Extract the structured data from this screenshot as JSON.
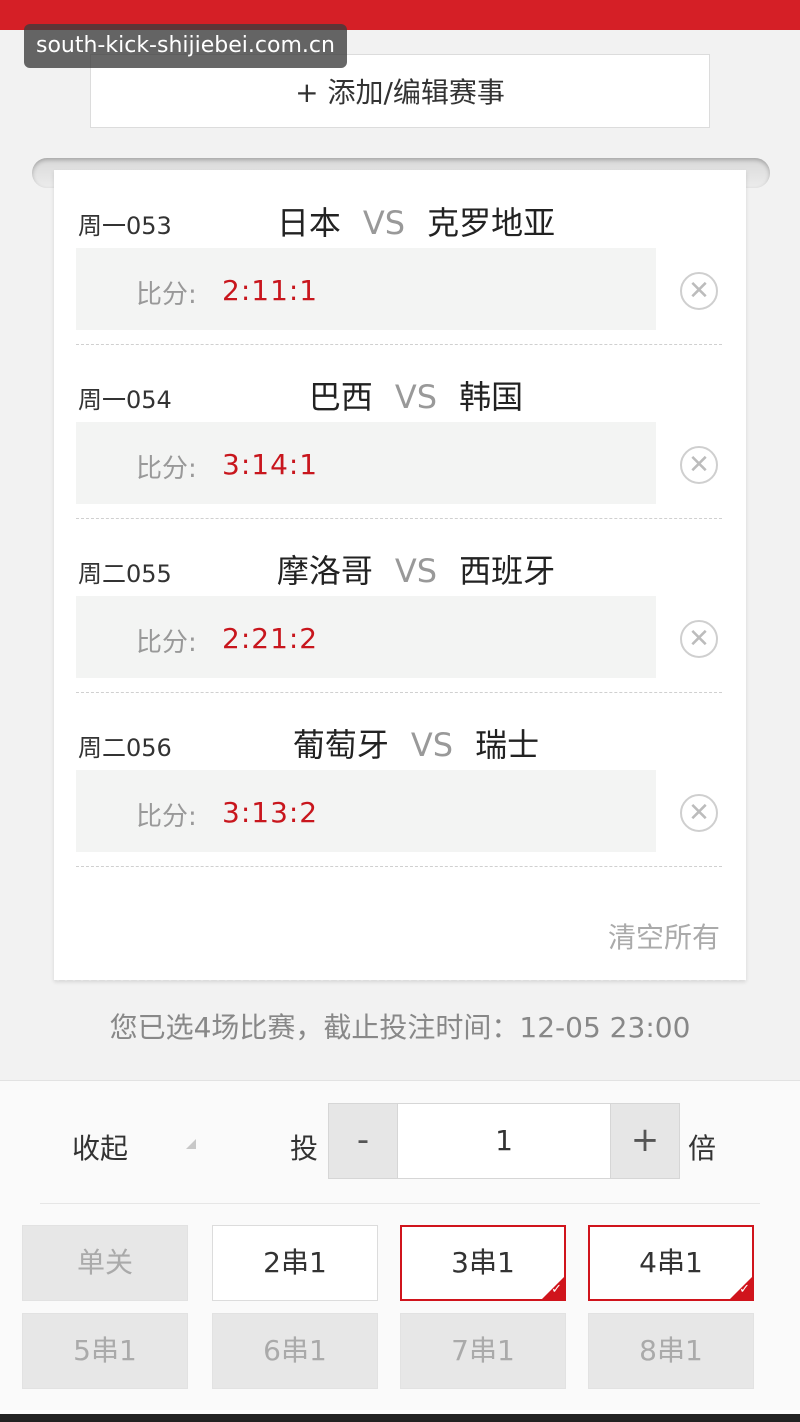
{
  "header": {
    "watermark": "south-kick-shijiebei.com.cn"
  },
  "add_button": {
    "icon": "plus-icon",
    "label": "+ 添加/编辑赛事"
  },
  "score_label": "比分:",
  "matches": [
    {
      "code": "周一053",
      "home": "日本",
      "vs": "VS",
      "away": "克罗地亚",
      "score": "2:11:1"
    },
    {
      "code": "周一054",
      "home": "巴西",
      "vs": "VS",
      "away": "韩国",
      "score": "3:14:1"
    },
    {
      "code": "周二055",
      "home": "摩洛哥",
      "vs": "VS",
      "away": "西班牙",
      "score": "2:21:2"
    },
    {
      "code": "周二056",
      "home": "葡萄牙",
      "vs": "VS",
      "away": "瑞士",
      "score": "3:13:2"
    }
  ],
  "clear_all": "清空所有",
  "summary": "您已选4场比赛，截止投注时间：12-05 23:00",
  "bet": {
    "collapse": "收起",
    "label_before": "投",
    "minus": "-",
    "multiplier": "1",
    "plus": "+",
    "label_after": "倍"
  },
  "combos": [
    {
      "label": "单关",
      "state": "disabled"
    },
    {
      "label": "2串1",
      "state": "normal"
    },
    {
      "label": "3串1",
      "state": "selected"
    },
    {
      "label": "4串1",
      "state": "selected"
    },
    {
      "label": "5串1",
      "state": "disabled"
    },
    {
      "label": "6串1",
      "state": "disabled"
    },
    {
      "label": "7串1",
      "state": "disabled"
    },
    {
      "label": "8串1",
      "state": "disabled"
    }
  ],
  "colors": {
    "brand_red": "#d51f26",
    "score_red": "#c8161d"
  }
}
